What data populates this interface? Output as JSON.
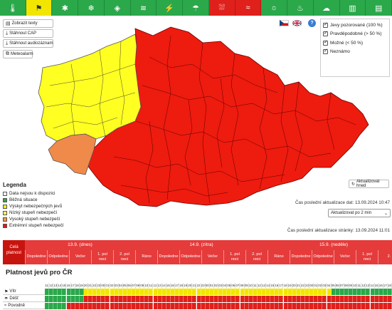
{
  "toolbar": {
    "tabs": [
      {
        "icon": "thermometer-heat-icon",
        "glyph": "🌡",
        "state": "green"
      },
      {
        "icon": "windsock-icon",
        "glyph": "⚑",
        "state": "active"
      },
      {
        "icon": "frost-icon",
        "glyph": "✱",
        "state": "green"
      },
      {
        "icon": "snow-icon",
        "glyph": "❄",
        "state": "green"
      },
      {
        "icon": "ice-icon",
        "glyph": "◈",
        "state": "green"
      },
      {
        "icon": "snowdrift-icon",
        "glyph": "≋",
        "state": "green"
      },
      {
        "icon": "thunderstorm-icon",
        "glyph": "⚡",
        "state": "green"
      },
      {
        "icon": "rain-icon",
        "glyph": "☂",
        "state": "green"
      },
      {
        "icon": "heavy-rain-icon",
        "glyph": "⛆",
        "state": "red"
      },
      {
        "icon": "flood-icon",
        "glyph": "≈",
        "state": "red"
      },
      {
        "icon": "drought-icon",
        "glyph": "☼",
        "state": "green"
      },
      {
        "icon": "fire-icon",
        "glyph": "♨",
        "state": "green"
      },
      {
        "icon": "smog-icon",
        "glyph": "☁",
        "state": "green"
      },
      {
        "icon": "factory-icon",
        "glyph": "▥",
        "state": "green"
      },
      {
        "icon": "extra-icon",
        "glyph": "▤",
        "state": "green"
      }
    ]
  },
  "left_buttons": {
    "show_texts": "Zobrazit texty",
    "download_cap": "Stáhnout CAP",
    "download_audio": "Stáhnout audiozáznam",
    "meteoalarm": "Meteoalarm"
  },
  "filters": {
    "observed": "Jevy pozorované (100 %)",
    "probable": "Pravděpodobné (> 50 %)",
    "possible": "Možné (< 50 %)",
    "unknown": "Neznámo"
  },
  "help_label": "?",
  "legend": {
    "title": "Legenda",
    "items": [
      {
        "label": "Data nejsou k dispozici",
        "color": "#ffffff"
      },
      {
        "label": "Běžná situace",
        "color": "#2aa84a"
      },
      {
        "label": "Výskyt nebezpečných jevů",
        "color": "#f2f000"
      },
      {
        "label": "Nízký stupeň nebezpečí",
        "color": "#ffff66"
      },
      {
        "label": "Vysoký stupeň nebezpečí",
        "color": "#f0964b"
      },
      {
        "label": "Extrémní stupeň nebezpečí",
        "color": "#e8130f"
      }
    ]
  },
  "refresh": {
    "button": "Aktualizovat hned",
    "interval": "Aktualizovat po 2 min"
  },
  "updates": {
    "data": "Čas poslední aktualizace dat: 13.09.2024 10:47",
    "page": "Čas poslední aktualizace stránky: 13.09.2024 11:01"
  },
  "timeline": {
    "now": "Celá\nplatnost",
    "days": [
      "13.9. (dnes)",
      "14.9. (zítra)",
      "15.9. (neděle)"
    ],
    "slots": [
      "Dopoledne",
      "Odpoledne",
      "Večer",
      "1. pol\nnoci",
      "2. pol\nnoci",
      "Ráno",
      "Dopoledne",
      "Odpoledne",
      "Večer",
      "1. pol\nnoci",
      "2. pol\nnoci",
      "Ráno",
      "Dopoledne",
      "Odpoledne",
      "Večer",
      "1. pol\nnoci",
      "2."
    ]
  },
  "validity": {
    "title": "Platnost jevů pro ČR",
    "hours_start": 11,
    "rows": [
      {
        "label": "Vítr",
        "icon": "windsock-icon",
        "glyph": "⚑",
        "pattern": "GGGGGGGGGYYYYYYYYYYYYYYYYYYYYYYYYYYYYYYYYYYYYYYYYYYYYYYYYYYYYYYYYYGGGGGGGGGGGGGG"
      },
      {
        "label": "Déšť",
        "icon": "rain-icon",
        "glyph": "☂",
        "pattern": "GGGGGGGGGRRRRRRRRRRRRRRRRRRRRRRRRRRRRRRRRRRRRRRRRRRRRRRRRRRRRRRRRRRRRRRRRRRRRRRR"
      },
      {
        "label": "Povodně",
        "icon": "flood-icon",
        "glyph": "≈",
        "pattern": "GGGGGRRRRRRRRRRRRRRRRRRRRRRRRRRRRRRRRRRRRRRRRRRRRRRRRRRRRRRRRRRRRRRRRRRRRRRRRRRR"
      }
    ]
  },
  "colors": {
    "green": "#2aa84a",
    "yellow": "#f2e600",
    "red": "#e0201b",
    "orange": "#ef8a4a",
    "map_red": "#ee1b0f",
    "map_yellow": "#ffff22"
  }
}
